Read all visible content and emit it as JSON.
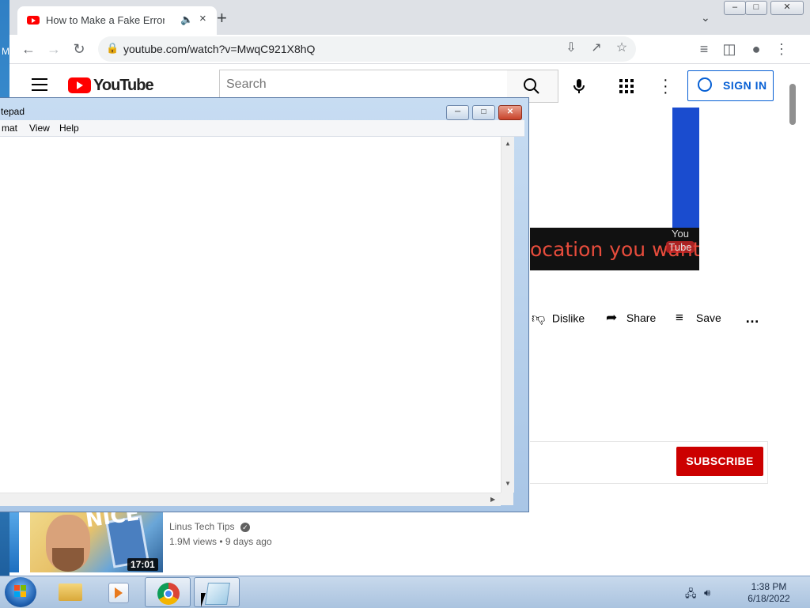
{
  "desktop": {
    "partial_label": "M"
  },
  "chrome": {
    "tab": {
      "title": "How to Make a Fake Error M",
      "audio_icon": "speaker-icon",
      "close": "×"
    },
    "new_tab": "+",
    "window": {
      "minimize": "–",
      "maximize": "□",
      "close": "✕"
    },
    "address": {
      "url": "youtube.com/watch?v=MwqC921X8hQ"
    }
  },
  "youtube": {
    "logo_text": "YouTube",
    "search": {
      "placeholder": "Search"
    },
    "sign_in": "SIGN IN",
    "video": {
      "caption_text": "ocation you want",
      "watermark_top": "You",
      "watermark_bottom": "Tube"
    },
    "actions": {
      "dislike": "Dislike",
      "share": "Share",
      "save": "Save"
    },
    "subscribe": "SUBSCRIBE",
    "recommendation": {
      "channel": "Linus Tech Tips",
      "views": "1.9M views",
      "age": "9 days ago",
      "duration": "17:01",
      "thumb_text": "NICE"
    }
  },
  "notepad": {
    "title": "tepad",
    "menu": [
      "mat",
      "View",
      "Help"
    ],
    "content": ""
  },
  "taskbar": {
    "time": "1:38 PM",
    "date": "6/18/2022"
  },
  "colors": {
    "youtube_red": "#ff0000",
    "subscribe_red": "#cc0000",
    "signin_blue": "#065fd4"
  }
}
